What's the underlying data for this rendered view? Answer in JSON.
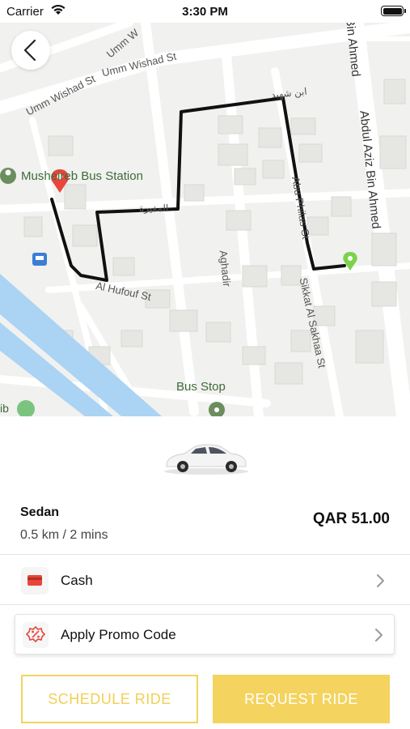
{
  "status_bar": {
    "carrier": "Carrier",
    "time": "3:30 PM"
  },
  "map": {
    "labels": {
      "umm_wishad_1": "Umm Wishad St",
      "umm_wishad_2": "Umm Wishad St",
      "umm_w": "Umm W",
      "arabic_1": "ابن شهيد",
      "arabic_2": "المغيرة",
      "poi_mushe": "Musheireb Bus Station",
      "al_hufouf": "Al Hufouf St",
      "aghadir": "Aghadir",
      "abu_philas": "Abu Philas St",
      "sikkat": "Sikkat Al Sakhaa St",
      "abdul_aziz": "Abdul Aziz Bin Ahmed",
      "bin_ahmed": "Bin Ahmed",
      "bus_stop": "Bus Stop",
      "ib": "ib"
    },
    "colors": {
      "route": "#111111",
      "pickup": "#e8463a",
      "dropoff": "#7bd24b",
      "water": "#aad3f4",
      "poi": "#6b8e5e"
    }
  },
  "ride": {
    "vehicle_name": "Sedan",
    "distance_time": "0.5 km / 2 mins",
    "price": "QAR 51.00"
  },
  "payment": {
    "icon": "credit-card-icon",
    "label": "Cash"
  },
  "promo": {
    "icon": "percent-badge-icon",
    "label": "Apply Promo Code"
  },
  "actions": {
    "schedule": "SCHEDULE RIDE",
    "request": "REQUEST RIDE"
  },
  "theme": {
    "accent": "#f4d35e"
  }
}
